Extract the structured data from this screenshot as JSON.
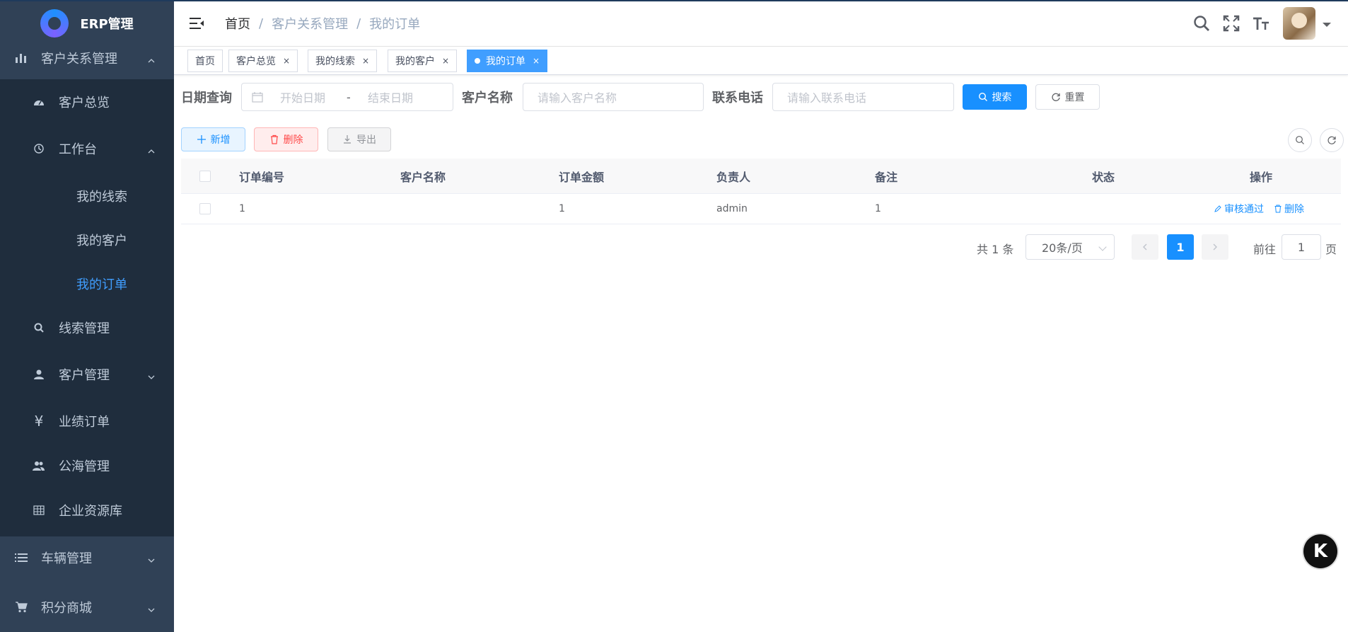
{
  "app": {
    "logo_text": "ERP管理"
  },
  "sidebar": {
    "crm": "客户关系管理",
    "overview": "客户总览",
    "workbench": "工作台",
    "my_leads": "我的线索",
    "my_customers": "我的客户",
    "my_orders": "我的订单",
    "lead_mgmt": "线索管理",
    "customer_mgmt": "客户管理",
    "perf_orders": "业绩订单",
    "public_pool": "公海管理",
    "enterprise_lib": "企业资源库",
    "vehicle_mgmt": "车辆管理",
    "points_mall": "积分商城"
  },
  "breadcrumb": {
    "home": "首页",
    "crm": "客户关系管理",
    "current": "我的订单",
    "sep": "/"
  },
  "tags": [
    {
      "label": "首页",
      "close": ""
    },
    {
      "label": "客户总览",
      "close": "×"
    },
    {
      "label": "我的线索",
      "close": "×"
    },
    {
      "label": "我的客户",
      "close": "×"
    },
    {
      "label": "我的订单",
      "close": "×"
    }
  ],
  "search": {
    "date_label": "日期查询",
    "start_placeholder": "开始日期",
    "range_sep": "-",
    "end_placeholder": "结束日期",
    "customer_label": "客户名称",
    "customer_placeholder": "请输入客户名称",
    "phone_label": "联系电话",
    "phone_placeholder": "请输入联系电话",
    "search_btn": "搜索",
    "reset_btn": "重置"
  },
  "toolbar": {
    "add": "新增",
    "delete": "删除",
    "export": "导出"
  },
  "table": {
    "columns": [
      "订单编号",
      "客户名称",
      "订单金额",
      "负责人",
      "备注",
      "状态",
      "操作"
    ],
    "rows": [
      {
        "order_no": "1",
        "customer": "",
        "amount": "1",
        "owner": "admin",
        "remark": "1",
        "status": "",
        "approve": "审核通过",
        "delete": "删除"
      }
    ]
  },
  "pagination": {
    "total": "共 1 条",
    "page_size": "20条/页",
    "current": "1",
    "goto_label": "前往",
    "goto_value": "1",
    "page_suffix": "页"
  },
  "float_button": "K",
  "colors": {
    "sidebar_bg": "#304156",
    "primary": "#1890ff",
    "active_menu": "#409eff"
  }
}
